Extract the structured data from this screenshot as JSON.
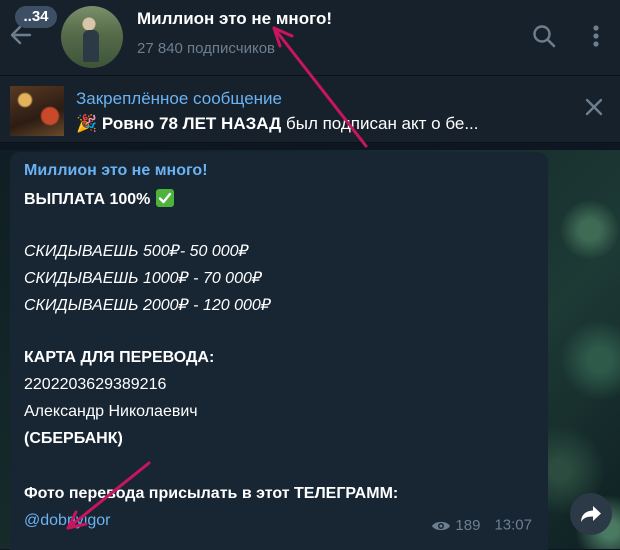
{
  "header": {
    "unread_count": "..34",
    "title": "Миллион это не много!",
    "subscribers": "27 840 подписчиков",
    "icons": {
      "back": "arrow-left-icon",
      "search": "search-icon",
      "more": "kebab-menu-icon"
    }
  },
  "pinned": {
    "title": "Закреплённое сообщение",
    "emoji": "🎉",
    "text_bold": "Ровно 78 ЛЕТ НАЗАД",
    "text_rest": " был подписан акт о бе..."
  },
  "message": {
    "sender": "Миллион это не много!",
    "line_payout": "ВЫПЛАТА 100%",
    "offers": [
      "СКИДЫВАЕШЬ 500₽- 50 000₽",
      "СКИДЫВАЕШЬ 1000₽ - 70 000₽",
      "СКИДЫВАЕШЬ 2000₽ - 120 000₽"
    ],
    "card_label": "КАРТА ДЛЯ ПЕРЕВОДА:",
    "card_number": "2202203629389216",
    "card_holder": "Александр Николаевич",
    "bank": "(СБЕРБАНК)",
    "photo_note": "Фото перевода присылать в этот ТЕЛЕГРАММ:",
    "contact": "@dobriyigor",
    "views": "189",
    "time": "13:07"
  },
  "colors": {
    "header_bg": "#17212b",
    "bubble_bg": "#182533",
    "accent": "#6ab2f2",
    "muted": "#6d7f8f",
    "annotation": "#c8155e"
  }
}
